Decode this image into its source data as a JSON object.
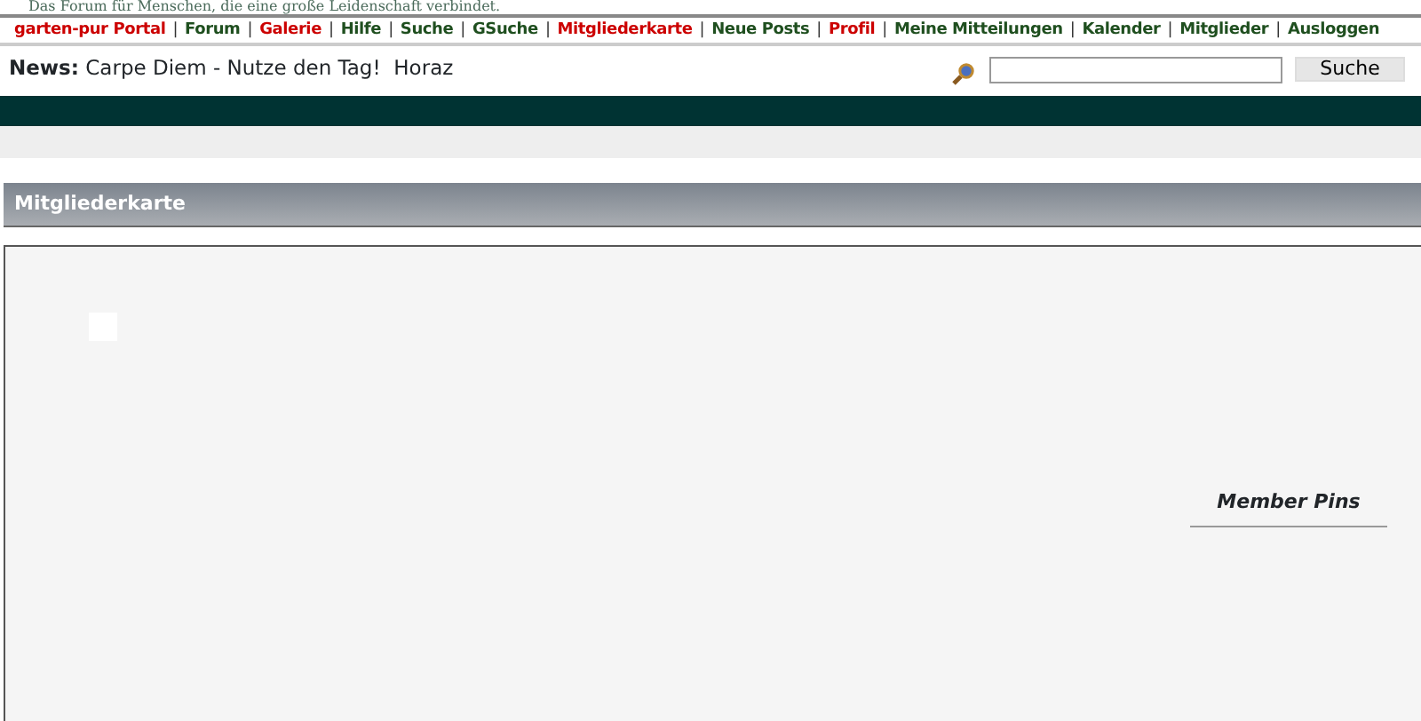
{
  "tagline": "Das Forum für Menschen, die eine große Leidenschaft verbindet.",
  "nav": {
    "separator": "|",
    "items": [
      {
        "label": "garten-pur Portal",
        "color": "#cc0000"
      },
      {
        "label": "Forum",
        "color": "#1f4f1f"
      },
      {
        "label": "Galerie",
        "color": "#cc0000"
      },
      {
        "label": "Hilfe",
        "color": "#1f4f1f"
      },
      {
        "label": "Suche",
        "color": "#1f4f1f"
      },
      {
        "label": "GSuche",
        "color": "#1f4f1f"
      },
      {
        "label": "Mitgliederkarte",
        "color": "#cc0000"
      },
      {
        "label": "Neue Posts",
        "color": "#1f4f1f"
      },
      {
        "label": "Profil",
        "color": "#cc0000"
      },
      {
        "label": "Meine Mitteilungen",
        "color": "#1f4f1f"
      },
      {
        "label": "Kalender",
        "color": "#1f4f1f"
      },
      {
        "label": "Mitglieder",
        "color": "#1f4f1f"
      },
      {
        "label": "Ausloggen",
        "color": "#1f4f1f"
      }
    ]
  },
  "news": {
    "label": "News:",
    "text": "Carpe Diem - Nutze den Tag!  Horaz"
  },
  "search": {
    "button": "Suche"
  },
  "section": {
    "title": "Mitgliederkarte"
  },
  "map": {
    "legend_title": "Member Pins"
  }
}
